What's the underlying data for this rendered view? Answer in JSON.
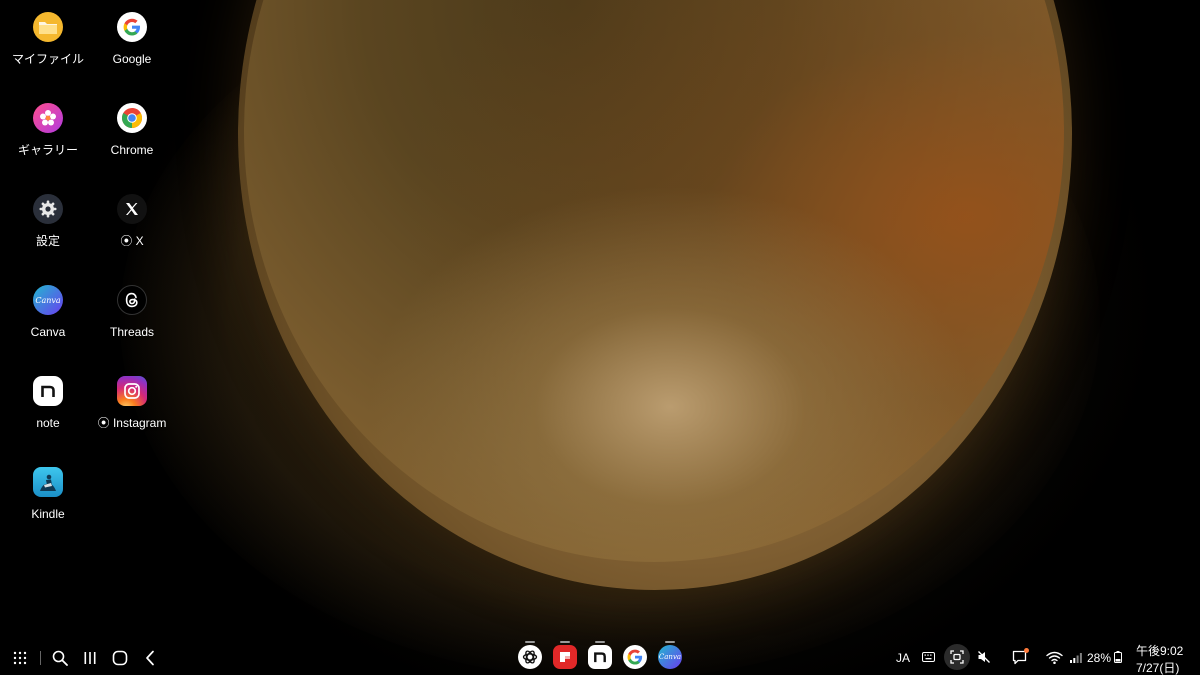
{
  "desktop": {
    "icons": [
      {
        "label": "マイファイル",
        "icon": "folder-icon"
      },
      {
        "label": "Google",
        "icon": "google-icon"
      },
      {
        "label": "ギャラリー",
        "icon": "gallery-flower-icon"
      },
      {
        "label": "Chrome",
        "icon": "chrome-icon"
      },
      {
        "label": "設定",
        "icon": "settings-gear-icon"
      },
      {
        "label": "⦿ X",
        "icon": "x-logo-icon"
      },
      {
        "label": "Canva",
        "icon": "canva-icon"
      },
      {
        "label": "Threads",
        "icon": "threads-icon"
      },
      {
        "label": "note",
        "icon": "note-icon"
      },
      {
        "label": "⦿ Instagram",
        "icon": "instagram-icon"
      },
      {
        "label": "Kindle",
        "icon": "kindle-icon"
      }
    ]
  },
  "taskbar": {
    "nav_icons": [
      "apps-grid-icon",
      "search-icon",
      "recents-icon",
      "home-icon",
      "back-icon"
    ],
    "dock_apps": [
      {
        "name": "chatgpt-icon"
      },
      {
        "name": "flipboard-icon"
      },
      {
        "name": "note-icon"
      },
      {
        "name": "google-icon"
      },
      {
        "name": "canva-icon",
        "text": "Canva"
      }
    ],
    "tray": {
      "language": "JA",
      "battery": "28%",
      "time": "午後9:02",
      "date": "7/27(日)"
    }
  },
  "colors": {
    "google_blue": "#4285F4",
    "google_red": "#EA4335",
    "google_yellow": "#FBBC05",
    "google_green": "#34A853",
    "canva_teal": "#22b8cf",
    "canva_purple": "#6a3df0",
    "folder_yellow": "#f5b82e",
    "notification_dot": "#ff7a3a"
  }
}
